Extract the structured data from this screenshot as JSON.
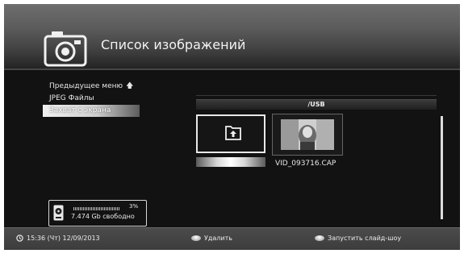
{
  "header": {
    "title": "Список изображений",
    "icon": "camera-icon"
  },
  "menu": {
    "items": [
      {
        "label": "Предыдущее меню",
        "icon": "up-arrow-icon",
        "icon_glyph": "🡅"
      },
      {
        "label": "JPEG Файлы"
      },
      {
        "label": "Захват с экрана",
        "selected": true
      }
    ]
  },
  "browser": {
    "path": "/USB",
    "tiles": [
      {
        "type": "folder-up",
        "icon": "folder-up-icon",
        "label": ""
      },
      {
        "type": "image",
        "icon": "thumbnail",
        "label": "VID_093716.CAP"
      }
    ]
  },
  "storage": {
    "usage_percent": 3,
    "usage_label": "3%",
    "free_label": "7.474 Gb свободно"
  },
  "footer": {
    "datetime": "15:36 (Чт) 12/09/2013",
    "delete_label": "Удалить",
    "slideshow_label": "Запустить слайд-шоу"
  },
  "colors": {
    "background": "#121212",
    "header": "#5a5a5a",
    "footer": "#404040",
    "text": "#f0f0f0",
    "selection": "#e0e0e0"
  }
}
